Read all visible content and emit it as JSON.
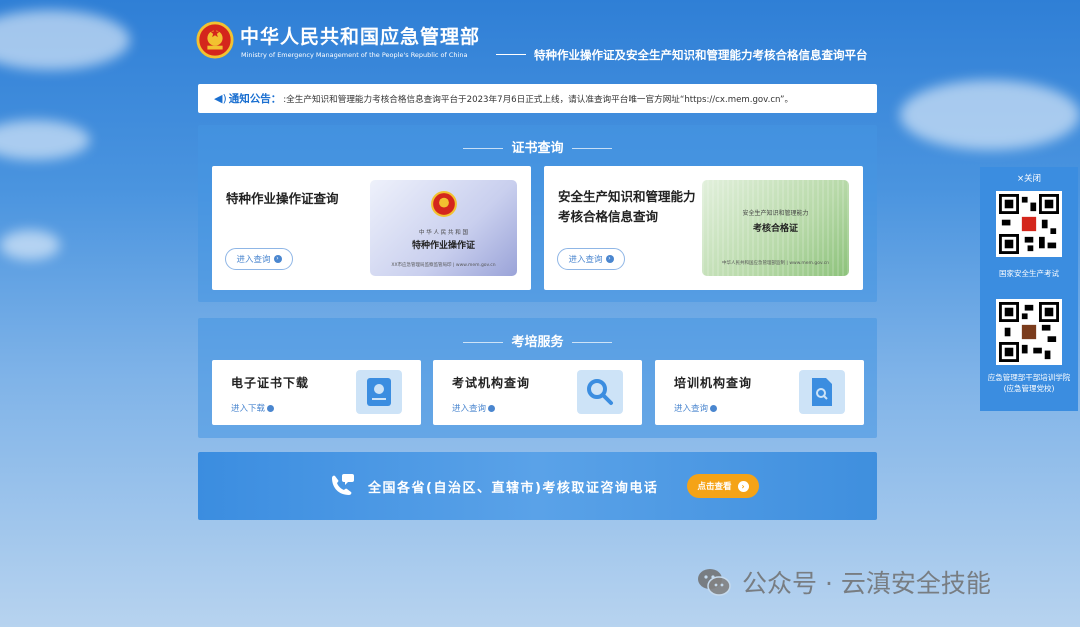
{
  "header": {
    "ministry_cn": "中华人民共和国应急管理部",
    "ministry_en": "Ministry of Emergency Management of the People's Republic of China",
    "platform_title": "特种作业操作证及安全生产知识和管理能力考核合格信息查询平台"
  },
  "notice": {
    "label": "通知公告：",
    "text": ":全生产知识和管理能力考核合格信息查询平台于2023年7月6日正式上线，请认准查询平台唯一官方网址“https://cx.mem.gov.cn”。"
  },
  "cert_section": {
    "title": "证书查询",
    "cards": [
      {
        "title": "特种作业操作证查询",
        "button": "进入查询",
        "img_small": "中 华 人 民 共 和 国",
        "img_main": "特种作业操作证",
        "img_foot": "XX市应急管理局监察监管局印 | www.mem.gov.cn"
      },
      {
        "title_line1": "安全生产知识和管理能力",
        "title_line2": "考核合格信息查询",
        "button": "进入查询",
        "img_small": "安全生产知识和管理能力",
        "img_main": "考核合格证",
        "img_foot": "中华人民共和国应急管理部监制 | www.mem.gov.cn"
      }
    ]
  },
  "exam_section": {
    "title": "考培服务",
    "cards": [
      {
        "title": "电子证书下载",
        "link": "进入下载",
        "icon": "certificate-icon"
      },
      {
        "title": "考试机构查询",
        "link": "进入查询",
        "icon": "magnifier-icon"
      },
      {
        "title": "培训机构查询",
        "link": "进入查询",
        "icon": "document-search-icon"
      }
    ]
  },
  "hotline": {
    "text": "全国各省(自治区、直辖市)考核取证咨询电话",
    "button": "点击查看"
  },
  "side_panel": {
    "close": "×关闭",
    "qr1_caption": "国家安全生产考试",
    "qr2_caption_line1": "应急管理部干部培训学院",
    "qr2_caption_line2": "(应急管理党校)"
  },
  "watermark": {
    "text": "公众号 · 云滇安全技能"
  },
  "colors": {
    "primary": "#3b8de0",
    "accent": "#f5a316",
    "link": "#4a86cf"
  }
}
